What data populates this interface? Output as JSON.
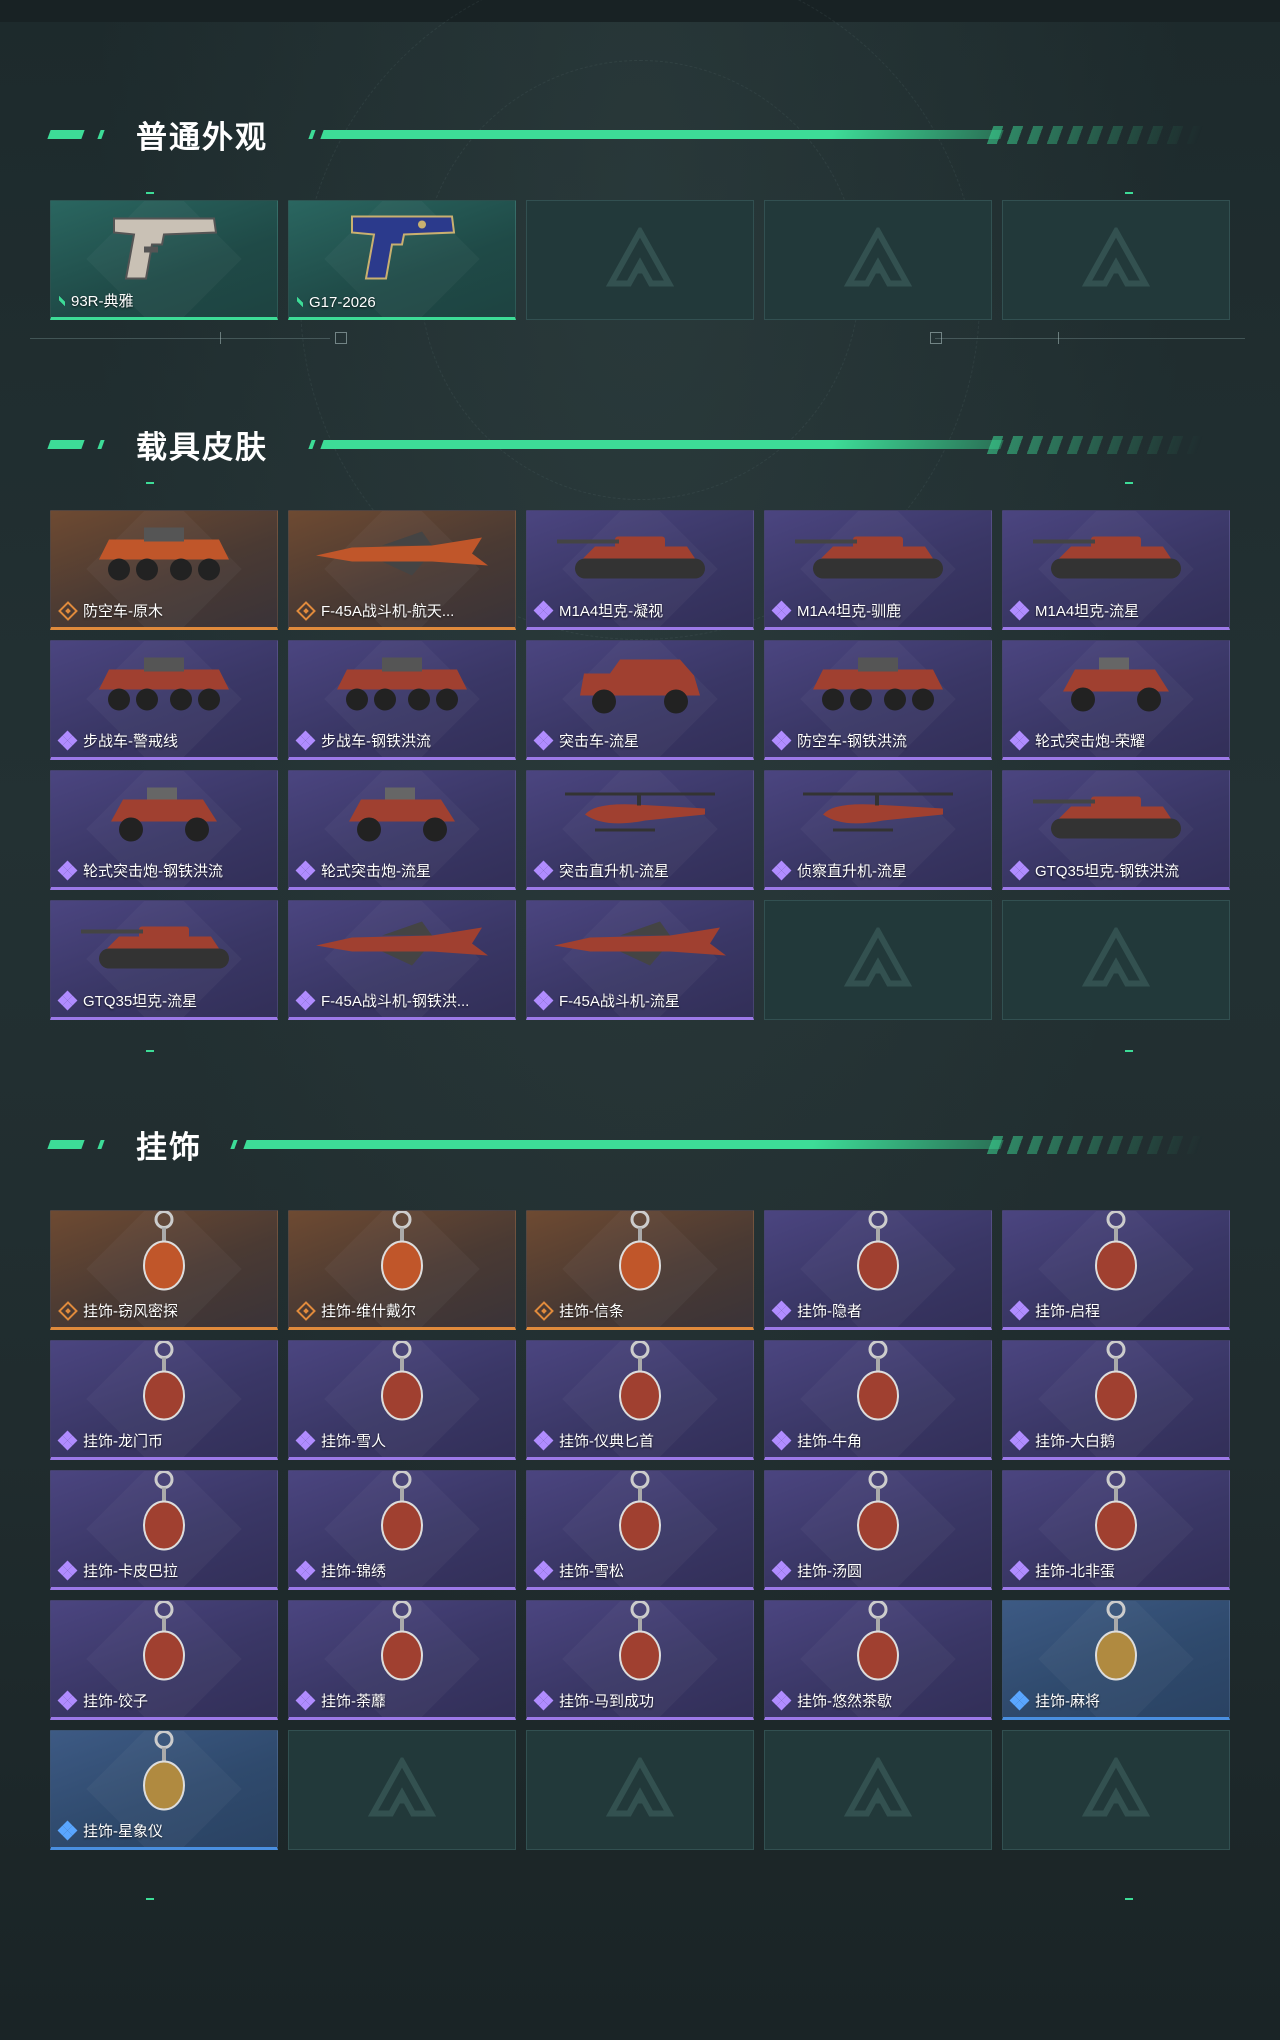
{
  "sections": {
    "appearance": {
      "title": "普通外观",
      "items": [
        {
          "label": "93R-典雅",
          "rarity": "green",
          "art": "pistol-icon"
        },
        {
          "label": "G17-2026",
          "rarity": "green",
          "art": "pistol-blue-icon"
        }
      ]
    },
    "vehicles": {
      "title": "载具皮肤",
      "items": [
        {
          "label": "防空车-原木",
          "rarity": "orange",
          "art": "apc-icon"
        },
        {
          "label": "F-45A战斗机-航天...",
          "rarity": "orange",
          "art": "jet-icon"
        },
        {
          "label": "M1A4坦克-凝视",
          "rarity": "purple",
          "art": "tank-icon"
        },
        {
          "label": "M1A4坦克-驯鹿",
          "rarity": "purple",
          "art": "tank-icon"
        },
        {
          "label": "M1A4坦克-流星",
          "rarity": "purple",
          "art": "tank-icon"
        },
        {
          "label": "步战车-警戒线",
          "rarity": "purple",
          "art": "apc-icon"
        },
        {
          "label": "步战车-钢铁洪流",
          "rarity": "purple",
          "art": "apc-icon"
        },
        {
          "label": "突击车-流星",
          "rarity": "purple",
          "art": "truck-icon"
        },
        {
          "label": "防空车-钢铁洪流",
          "rarity": "purple",
          "art": "apc-icon"
        },
        {
          "label": "轮式突击炮-荣耀",
          "rarity": "purple",
          "art": "buggy-icon"
        },
        {
          "label": "轮式突击炮-钢铁洪流",
          "rarity": "purple",
          "art": "buggy-icon"
        },
        {
          "label": "轮式突击炮-流星",
          "rarity": "purple",
          "art": "buggy-icon"
        },
        {
          "label": "突击直升机-流星",
          "rarity": "purple",
          "art": "helicopter-icon"
        },
        {
          "label": "侦察直升机-流星",
          "rarity": "purple",
          "art": "helicopter-icon"
        },
        {
          "label": "GTQ35坦克-钢铁洪流",
          "rarity": "purple",
          "art": "tank-icon"
        },
        {
          "label": "GTQ35坦克-流星",
          "rarity": "purple",
          "art": "tank-icon"
        },
        {
          "label": "F-45A战斗机-钢铁洪...",
          "rarity": "purple",
          "art": "jet-icon"
        },
        {
          "label": "F-45A战斗机-流星",
          "rarity": "purple",
          "art": "jet-icon"
        }
      ]
    },
    "charms": {
      "title": "挂饰",
      "items": [
        {
          "label": "挂饰-窃风密探",
          "rarity": "orange",
          "art": "charm-icon"
        },
        {
          "label": "挂饰-维什戴尔",
          "rarity": "orange",
          "art": "charm-icon"
        },
        {
          "label": "挂饰-信条",
          "rarity": "orange",
          "art": "charm-icon"
        },
        {
          "label": "挂饰-隐者",
          "rarity": "purple",
          "art": "charm-icon"
        },
        {
          "label": "挂饰-启程",
          "rarity": "purple",
          "art": "charm-icon"
        },
        {
          "label": "挂饰-龙门币",
          "rarity": "purple",
          "art": "charm-icon"
        },
        {
          "label": "挂饰-雪人",
          "rarity": "purple",
          "art": "charm-icon"
        },
        {
          "label": "挂饰-仪典匕首",
          "rarity": "purple",
          "art": "charm-icon"
        },
        {
          "label": "挂饰-牛角",
          "rarity": "purple",
          "art": "charm-icon"
        },
        {
          "label": "挂饰-大白鹅",
          "rarity": "purple",
          "art": "charm-icon"
        },
        {
          "label": "挂饰-卡皮巴拉",
          "rarity": "purple",
          "art": "charm-icon"
        },
        {
          "label": "挂饰-锦绣",
          "rarity": "purple",
          "art": "charm-icon"
        },
        {
          "label": "挂饰-雪松",
          "rarity": "purple",
          "art": "charm-icon"
        },
        {
          "label": "挂饰-汤圆",
          "rarity": "purple",
          "art": "charm-icon"
        },
        {
          "label": "挂饰-北非蛋",
          "rarity": "purple",
          "art": "charm-icon"
        },
        {
          "label": "挂饰-饺子",
          "rarity": "purple",
          "art": "charm-icon"
        },
        {
          "label": "挂饰-荼蘼",
          "rarity": "purple",
          "art": "charm-icon"
        },
        {
          "label": "挂饰-马到成功",
          "rarity": "purple",
          "art": "charm-icon"
        },
        {
          "label": "挂饰-悠然茶歇",
          "rarity": "purple",
          "art": "charm-icon"
        },
        {
          "label": "挂饰-麻将",
          "rarity": "blue",
          "art": "charm-icon"
        },
        {
          "label": "挂饰-星象仪",
          "rarity": "blue",
          "art": "charm-icon"
        }
      ]
    }
  },
  "colors": {
    "accent": "#3ddc97",
    "orange": "#e08a3c",
    "purple": "#9c79e8",
    "blue": "#4a8fe0",
    "empty": "#22393a"
  }
}
